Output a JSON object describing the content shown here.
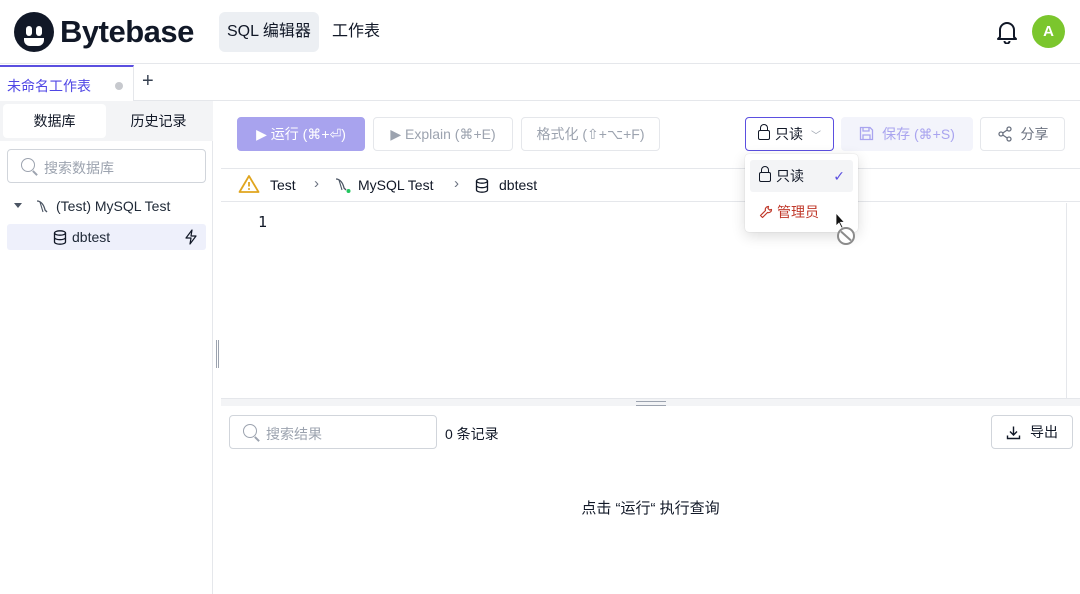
{
  "app": {
    "brand": "Bytebase",
    "nav": [
      "SQL 编辑器",
      "工作表"
    ],
    "avatar_letter": "A",
    "accent_color": "#5b4fe0"
  },
  "tabs": {
    "active_label": "未命名工作表",
    "add_label": "+"
  },
  "sidebar": {
    "tabs": [
      "数据库",
      "历史记录"
    ],
    "search_placeholder": "搜索数据库",
    "tree": {
      "instance_label": "(Test) MySQL Test",
      "database_label": "dbtest"
    }
  },
  "toolbar": {
    "run_label": "▶ 运行 (⌘+⏎)",
    "explain_label": "▶ Explain (⌘+E)",
    "format_label": "格式化 (⇧+⌥+F)",
    "mode_label": "只读",
    "save_label": "保存 (⌘+S)",
    "share_label": "分享"
  },
  "breadcrumb": {
    "environment": "Test",
    "instance": "MySQL Test",
    "database": "dbtest",
    "separator": "›"
  },
  "editor": {
    "line_numbers": [
      "1"
    ]
  },
  "results": {
    "search_placeholder": "搜索结果",
    "count_label": "0 条记录",
    "export_label": "导出",
    "empty_message": "点击 “运行“ 执行查询"
  },
  "mode_dropdown": {
    "items": [
      {
        "label": "只读",
        "selected": true,
        "icon": "lock-icon"
      },
      {
        "label": "管理员",
        "selected": false,
        "icon": "wrench-icon"
      }
    ],
    "check_mark": "✓"
  }
}
